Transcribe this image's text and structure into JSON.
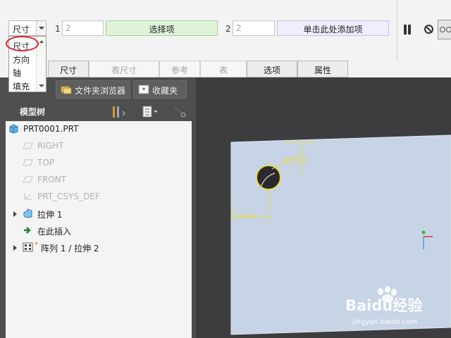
{
  "dashboard": {
    "type_select": {
      "value": "尺寸",
      "options": [
        "尺寸",
        "方向",
        "轴",
        "填充"
      ]
    },
    "collector1": {
      "index": "1",
      "count": "2",
      "label": "选择项"
    },
    "collector2": {
      "index": "2",
      "count": "2",
      "label": "单击此处添加项"
    },
    "tabs": [
      {
        "label": "尺寸",
        "active": true
      },
      {
        "label": "表尺寸",
        "active": false
      },
      {
        "label": "参考",
        "active": false
      },
      {
        "label": "表",
        "active": false
      },
      {
        "label": "选项",
        "active": true
      },
      {
        "label": "属性",
        "active": true
      }
    ]
  },
  "navigator": {
    "tabs": [
      {
        "label": "文件夹浏览器",
        "icon": "folder-browser-icon"
      },
      {
        "label": "收藏夹",
        "icon": "favorites-icon"
      }
    ],
    "tree_title": "模型树",
    "items": [
      {
        "label": "PRT0001.PRT",
        "icon": "part-icon",
        "disabled": false
      },
      {
        "label": "RIGHT",
        "icon": "datum-plane-icon",
        "disabled": true
      },
      {
        "label": "TOP",
        "icon": "datum-plane-icon",
        "disabled": true
      },
      {
        "label": "FRONT",
        "icon": "datum-plane-icon",
        "disabled": true
      },
      {
        "label": "PRT_CSYS_DEF",
        "icon": "csys-icon",
        "disabled": true
      },
      {
        "label": "拉伸 1",
        "icon": "extrude-icon",
        "disabled": false
      },
      {
        "label": "在此插入",
        "icon": "insert-here-icon",
        "disabled": false
      },
      {
        "label": "阵列 1 / 拉伸 2",
        "icon": "pattern-icon",
        "disabled": false
      }
    ]
  },
  "graphics": {
    "dim_diameter": "Ø10.00",
    "dim_offset": "15.00"
  },
  "watermark": {
    "brand": "Baidu经验",
    "url": "jingyan.baidu.com"
  },
  "colors": {
    "accent_red": "#d8232a",
    "collector_green": "#dff3d8",
    "plate": "#c7d4e6",
    "dimension": "#e8d84a"
  }
}
